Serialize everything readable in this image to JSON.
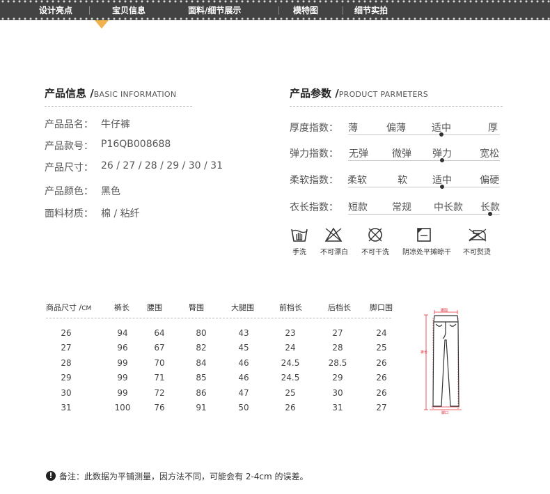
{
  "nav": {
    "items": [
      "设计亮点",
      "宝贝信息",
      "面料/细节展示",
      "模特图",
      "细节实拍"
    ],
    "active_index": 1,
    "colors": {
      "bar": "#434343",
      "arrow": "#f0b24f"
    }
  },
  "product_info": {
    "title_cn": "产品信息 /",
    "title_en": "BASIC INFORMATION",
    "rows": [
      {
        "label": "产品品名：",
        "value": "牛仔裤"
      },
      {
        "label": "产品款号：",
        "value": "P16QB008688"
      },
      {
        "label": "产品尺寸：",
        "value": "26 / 27 / 28 / 29 / 30 / 31"
      },
      {
        "label": "产品颜色：",
        "value": "黑色"
      },
      {
        "label": "面料材质：",
        "value": "棉 / 粘纤"
      }
    ]
  },
  "product_params": {
    "title_cn": "产品参数 /",
    "title_en": "PRODUCT PARMETERS",
    "rows": [
      {
        "label": "厚度指数：",
        "options": [
          "薄",
          "偏薄",
          "适中",
          "厚"
        ],
        "selected": 2
      },
      {
        "label": "弹力指数：",
        "options": [
          "无弹",
          "微弹",
          "弹力",
          "宽松"
        ],
        "selected": 2
      },
      {
        "label": "柔软指数：",
        "options": [
          "柔软",
          "软",
          "适中",
          "偏硬"
        ],
        "selected": 2
      },
      {
        "label": "衣长指数：",
        "options": [
          "短款",
          "常规",
          "中长款",
          "长款"
        ],
        "selected": 3
      }
    ]
  },
  "care": [
    {
      "icon": "hand-wash-icon",
      "label": "手洗"
    },
    {
      "icon": "no-bleach-icon",
      "label": "不可漂白"
    },
    {
      "icon": "no-dry-clean-icon",
      "label": "不可干洗"
    },
    {
      "icon": "shade-flat-dry-icon",
      "label": "阴凉处平摊晾干"
    },
    {
      "icon": "no-iron-icon",
      "label": "不可熨烫"
    }
  ],
  "size_table": {
    "header_first": "商品尺寸 /",
    "header_unit": "CM",
    "headers": [
      "裤长",
      "腰围",
      "臀围",
      "大腿围",
      "前档长",
      "后档长",
      "脚口围"
    ],
    "rows": [
      [
        "26",
        "94",
        "64",
        "80",
        "43",
        "23",
        "27",
        "24"
      ],
      [
        "27",
        "96",
        "67",
        "82",
        "45",
        "24",
        "28",
        "25"
      ],
      [
        "28",
        "99",
        "70",
        "84",
        "46",
        "24.5",
        "28.5",
        "26"
      ],
      [
        "29",
        "99",
        "71",
        "85",
        "46",
        "24.5",
        "29",
        "26"
      ],
      [
        "30",
        "99",
        "72",
        "86",
        "47",
        "25",
        "30",
        "26"
      ],
      [
        "31",
        "100",
        "76",
        "91",
        "50",
        "26",
        "31",
        "27"
      ]
    ]
  },
  "diagram": {
    "waist_label": "腰围",
    "length_label": "裤长",
    "hem_label": "脚口",
    "accent_color": "#e0303a"
  },
  "note": {
    "icon": "exclamation-icon",
    "text": "备注：此数据为平铺测量，因方法不同，可能会有 2-4cm 的误差。"
  }
}
